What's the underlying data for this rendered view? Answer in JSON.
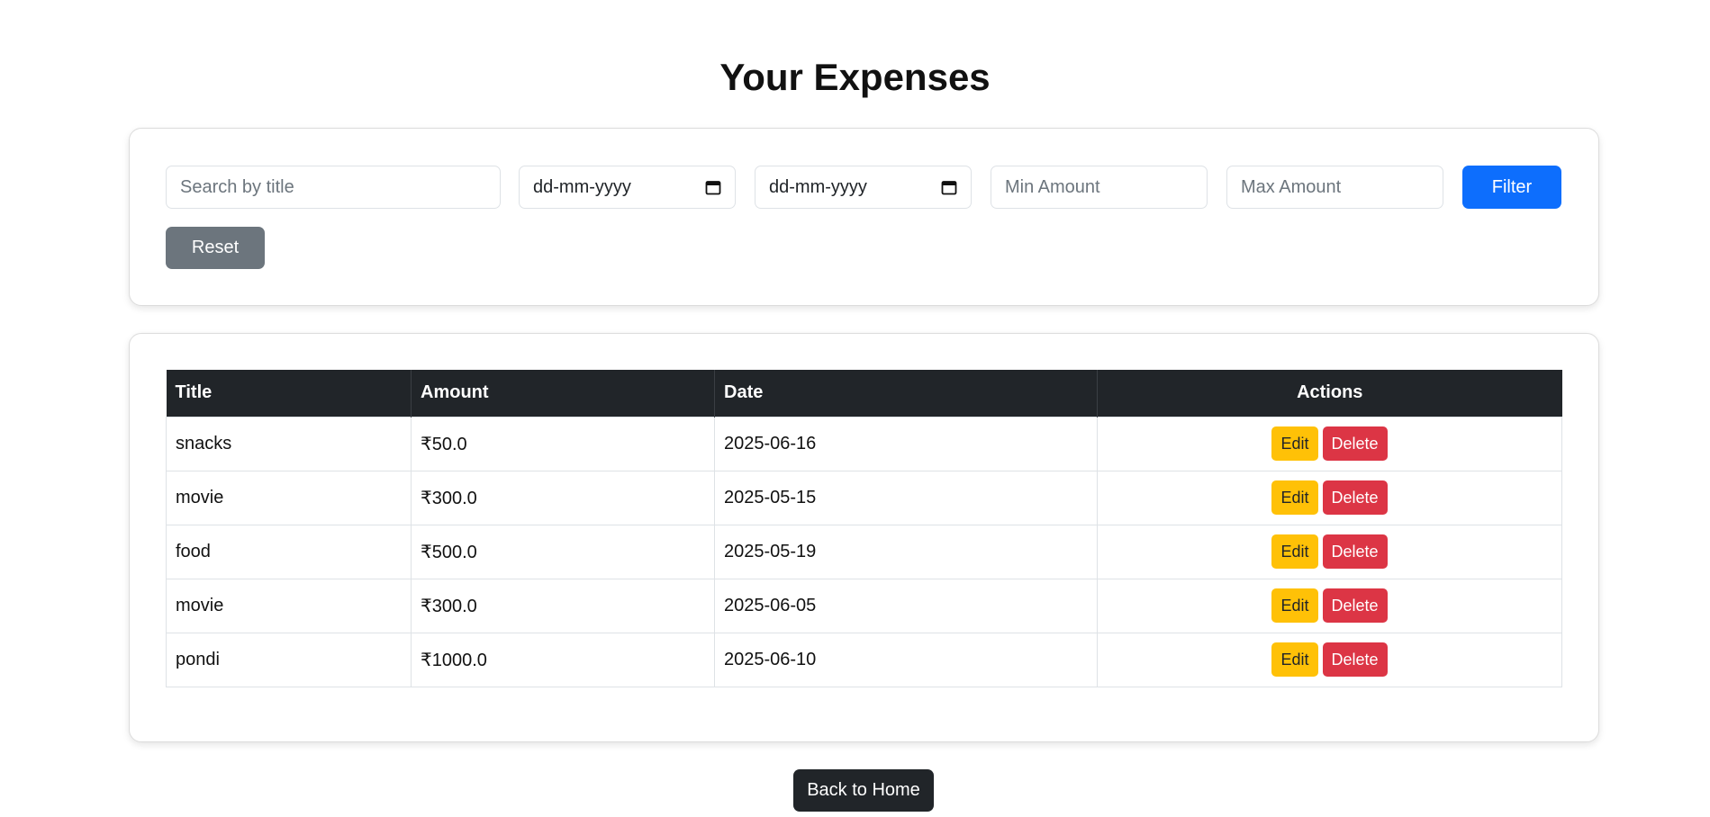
{
  "page": {
    "title": "Your Expenses"
  },
  "filters": {
    "search_placeholder": "Search by title",
    "start_date": "dd-mm-yyyy",
    "end_date": "dd-mm-yyyy",
    "min_placeholder": "Min Amount",
    "max_placeholder": "Max Amount",
    "filter_label": "Filter",
    "reset_label": "Reset"
  },
  "table": {
    "headers": {
      "title": "Title",
      "amount": "Amount",
      "date": "Date",
      "actions": "Actions"
    },
    "rows": [
      {
        "title": "snacks",
        "amount": "₹50.0",
        "date": "2025-06-16"
      },
      {
        "title": "movie",
        "amount": "₹300.0",
        "date": "2025-05-15"
      },
      {
        "title": "food",
        "amount": "₹500.0",
        "date": "2025-05-19"
      },
      {
        "title": "movie",
        "amount": "₹300.0",
        "date": "2025-06-05"
      },
      {
        "title": "pondi",
        "amount": "₹1000.0",
        "date": "2025-06-10"
      }
    ],
    "edit_label": "Edit",
    "delete_label": "Delete"
  },
  "footer": {
    "home_label": "Back to Home"
  },
  "colors": {
    "primary": "#0d6efd",
    "secondary": "#6c757d",
    "warning": "#ffc107",
    "danger": "#dc3545",
    "dark": "#212529"
  }
}
